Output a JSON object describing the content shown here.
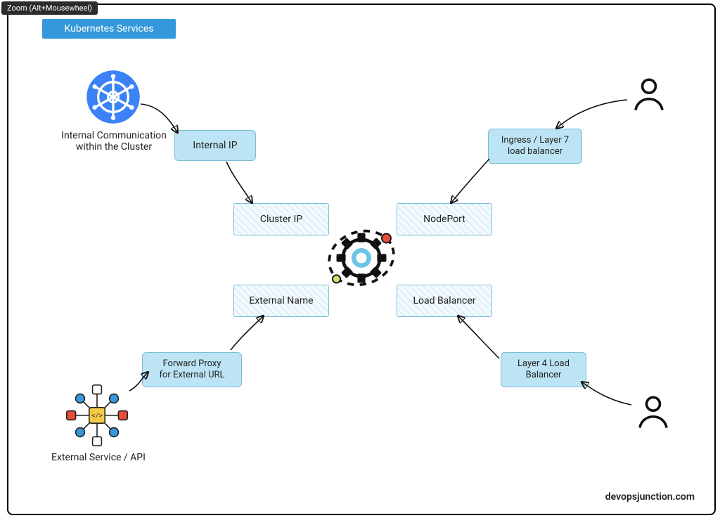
{
  "tooltip": "Zoom (Alt+Mousewheel)",
  "title": "Kubernetes Services",
  "labels": {
    "internal_comm_l1": "Internal Communication",
    "internal_comm_l2": "within the Cluster",
    "external_service": "External Service / API"
  },
  "boxes": {
    "internal_ip": "Internal IP",
    "ingress_l1": "Ingress / Layer 7",
    "ingress_l2": "load balancer",
    "forward_proxy_l1": "Forward Proxy",
    "forward_proxy_l2": "for External URL",
    "layer4_l1": "Layer 4 Load",
    "layer4_l2": "Balancer",
    "cluster_ip": "Cluster IP",
    "nodeport": "NodePort",
    "external_name": "External Name",
    "load_balancer": "Load Balancer"
  },
  "attribution": "devopsjunction.com"
}
